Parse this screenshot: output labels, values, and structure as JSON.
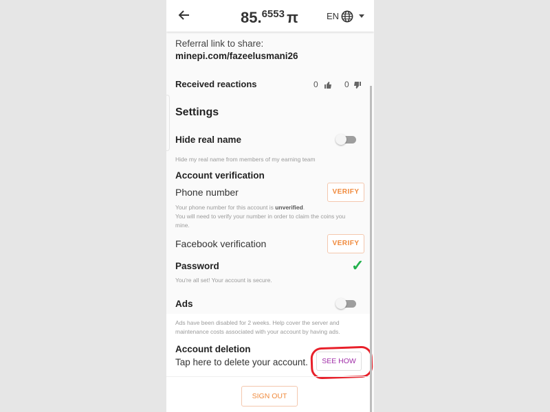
{
  "header": {
    "back_icon": "arrow-left-icon",
    "balance_main": "85.",
    "balance_decimal": "6553",
    "currency": "π",
    "language": "EN",
    "globe_icon": "globe-icon",
    "dropdown_icon": "caret-down-icon"
  },
  "referral": {
    "label": "Referral link to share:",
    "link": "minepi.com/fazeelusmani26"
  },
  "reactions": {
    "label": "Received reactions",
    "likes": "0",
    "dislikes": "0"
  },
  "settings": {
    "heading": "Settings",
    "hide_real_name": {
      "label": "Hide real name",
      "description": "Hide my real name from members of my earning team",
      "enabled": false
    },
    "account_verification": {
      "heading": "Account verification",
      "phone": {
        "label": "Phone number",
        "button": "VERIFY",
        "desc_prefix": "Your phone number for this account is ",
        "desc_status": "unverified",
        "desc_suffix": ".",
        "desc_line2": "You will need to verify your number in order to claim the coins you",
        "desc_line3": "mine."
      },
      "facebook": {
        "label": "Facebook verification",
        "button": "VERIFY"
      },
      "password": {
        "label": "Password",
        "description": "You're all set! Your account is secure.",
        "status_icon": "checkmark-icon"
      }
    },
    "ads": {
      "label": "Ads",
      "enabled": false,
      "desc_line1": "Ads have been disabled for 2 weeks. Help cover the server and",
      "desc_line2": "maintenance costs associated with your account by having ads."
    },
    "account_deletion": {
      "heading": "Account deletion",
      "description": "Tap here to delete your account.",
      "button": "SEE HOW"
    }
  },
  "sign_out": "SIGN OUT",
  "colors": {
    "accent": "#f08a3c",
    "see_how": "#a02ea8",
    "check": "#22b14c",
    "annotation": "#e8202a"
  }
}
